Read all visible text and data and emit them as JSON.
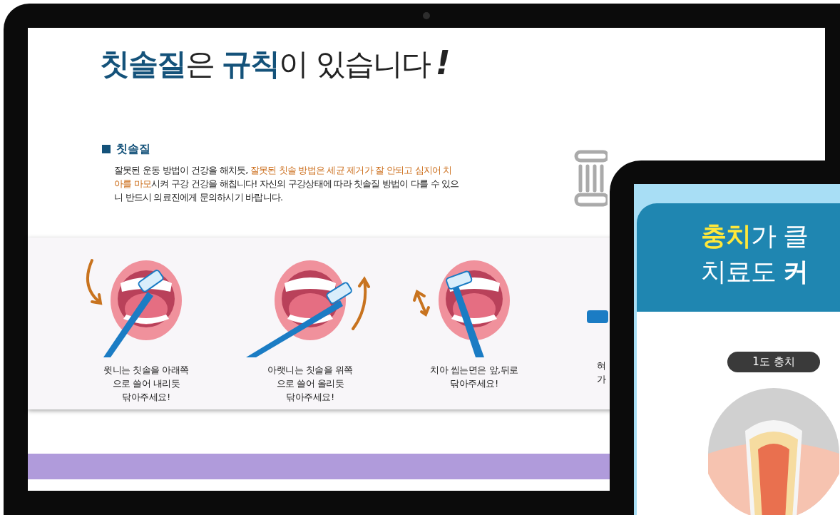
{
  "tablet": {
    "title": {
      "segments": [
        {
          "text": "칫솔질",
          "emphasized": true
        },
        {
          "text": "은 ",
          "emphasized": false
        },
        {
          "text": "규칙",
          "emphasized": true
        },
        {
          "text": "이 있습니다",
          "emphasized": false
        }
      ],
      "exclamation": "!"
    },
    "section": {
      "heading": "칫솔질",
      "paragraph": [
        {
          "text": "잘못된 운동 방법이 건강을 해치듯, ",
          "highlight": false
        },
        {
          "text": "잘못된 칫솔 방법은 세균 제거가 잘 안되고 심지어 치아를 마모",
          "highlight": true
        },
        {
          "text": "시켜 구강 건강을 해칩니다! 자신의 구강상태에 따라 칫솔질 방법이 다를 수 있으니 반드시 의료진에게 문의하시기 바랍니다.",
          "highlight": false
        }
      ]
    },
    "steps": [
      {
        "kind": "down",
        "caption": "윗니는 칫솔을 아래쪽\n으로 쓸어 내리듯\n닦아주세요!"
      },
      {
        "kind": "up",
        "caption": "아랫니는 칫솔을 위쪽\n으로 쓸어 올리듯\n닦아주세요!"
      },
      {
        "kind": "back_forth",
        "caption": "치아 씹는면은 앞,뒤로\n닦아주세요!"
      },
      {
        "kind": "cut",
        "caption": "혀\n가"
      }
    ]
  },
  "phone": {
    "title_lines": [
      [
        {
          "text": "충치",
          "emphasized": true,
          "color": "#ffe83a"
        },
        {
          "text": "가 클",
          "emphasized": false,
          "color": "#ffffff"
        }
      ],
      [
        {
          "text": "치료도 ",
          "emphasized": false,
          "color": "#ffffff"
        },
        {
          "text": "커",
          "emphasized": true,
          "color": "#ffffff"
        }
      ]
    ],
    "badge": "1도 충치"
  }
}
